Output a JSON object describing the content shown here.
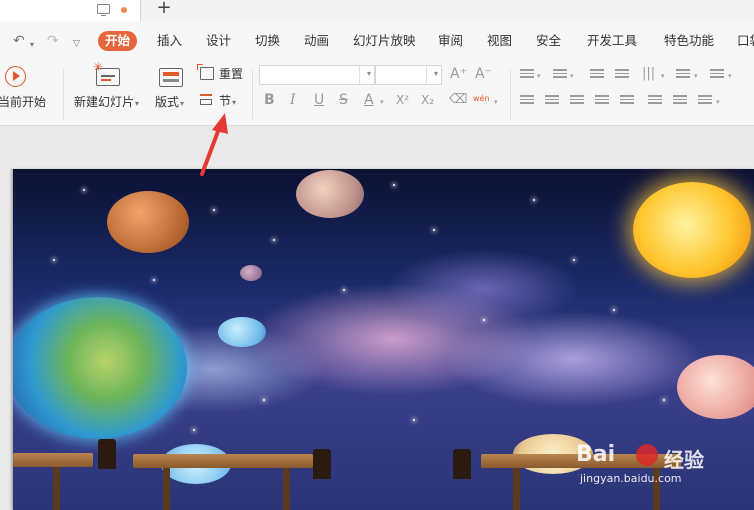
{
  "tabstrip": {
    "new_tab_symbol": "+"
  },
  "quick_access": {
    "undo_icon": "undo-icon",
    "redo_icon": "redo-icon",
    "customize_icon": "customize-icon"
  },
  "menu": {
    "tabs": [
      {
        "label": "开始",
        "active": true
      },
      {
        "label": "插入"
      },
      {
        "label": "设计"
      },
      {
        "label": "切换"
      },
      {
        "label": "动画"
      },
      {
        "label": "幻灯片放映"
      },
      {
        "label": "审阅"
      },
      {
        "label": "视图"
      },
      {
        "label": "安全"
      },
      {
        "label": "开发工具"
      },
      {
        "label": "特色功能"
      },
      {
        "label": "口袋"
      }
    ],
    "accent_color": "#e8643a"
  },
  "ribbon": {
    "play_current": "当前开始",
    "new_slide": "新建幻灯片",
    "layout": "版式",
    "reset": "重置",
    "section": "节",
    "font_name": "",
    "font_size": "",
    "bold": "B",
    "italic": "I",
    "underline": "U",
    "strikethrough": "S",
    "font_color": "A",
    "superscript": "X²",
    "subscript": "X₂",
    "phonetic": "wén",
    "increase_font": "A⁺",
    "decrease_font": "A⁻"
  },
  "watermark": {
    "brand": "Bai",
    "brand_suffix": "经验",
    "url": "jingyan.baidu.com"
  },
  "annotation": {
    "arrow_color": "#e53935",
    "points_to": "节"
  }
}
